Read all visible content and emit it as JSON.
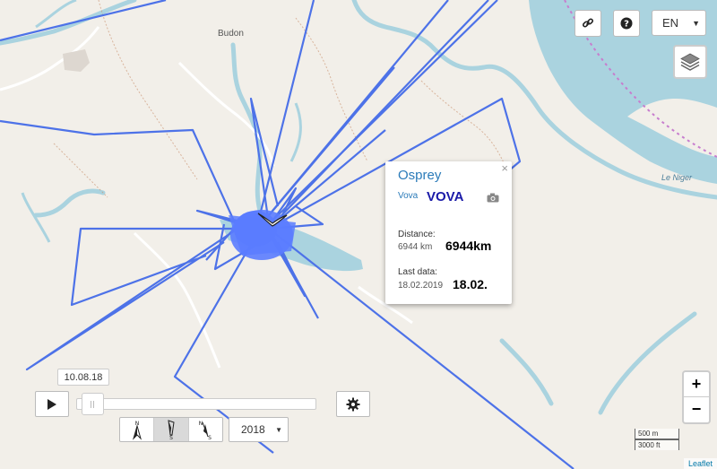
{
  "map": {
    "labels": {
      "town": "Budon",
      "river": "Le Niger"
    },
    "colors": {
      "land": "#f2efe9",
      "water": "#aad3df",
      "track": "#4d72e8",
      "track_dense": "#5b7cff",
      "road": "#ffffff",
      "path": "#c88e6a",
      "border": "#c77dce"
    }
  },
  "top_controls": {
    "link_icon": "link-icon",
    "help_icon": "help-icon",
    "language": {
      "selected": "EN"
    },
    "layers_icon": "layers-icon"
  },
  "popup": {
    "close": "×",
    "title": "Osprey",
    "name_small": "Vova",
    "name_big": "VOVA",
    "camera_icon": "camera-icon",
    "distance_label": "Distance:",
    "distance_small": "6944 km",
    "distance_big": "6944km",
    "lastdata_label": "Last data:",
    "lastdata_small": "18.02.2019",
    "lastdata_big": "18.02."
  },
  "player": {
    "date_tooltip": "10.08.18",
    "play_icon": "play-icon",
    "settings_icon": "gear-icon",
    "orientation": [
      {
        "name": "north-up",
        "top": "N",
        "bottom": ""
      },
      {
        "name": "south",
        "top": "",
        "bottom": "S"
      },
      {
        "name": "north-south",
        "top": "N",
        "bottom": "S"
      }
    ],
    "year": "2018",
    "progress": 0.02
  },
  "zoom": {
    "in": "+",
    "out": "−"
  },
  "scale": {
    "metric": "500 m",
    "imperial": "3000 ft"
  },
  "attribution": "Leaflet"
}
